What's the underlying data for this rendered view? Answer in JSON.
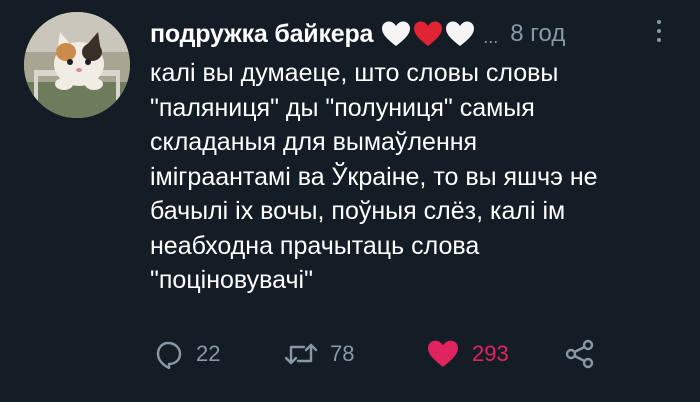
{
  "tweet": {
    "author_name": "подружка байкера",
    "name_emoji": [
      "white-heart",
      "red-heart",
      "white-heart"
    ],
    "ellipsis": "...",
    "time": "8 год",
    "text_lines": [
      "калі вы думаеце, што словы словы",
      "\"паляниця\" ды \"полуниця\" самыя",
      "складаныя для вымаўлення",
      "іміграантамі ва Ўкраіне, то вы яшчэ не",
      "бачылі іх вочы, поўныя слёз, калі ім",
      "неабходна прачытаць слова",
      "\"поціновувачі\""
    ]
  },
  "actions": {
    "reply_count": "22",
    "retweet_count": "78",
    "like_count": "293"
  },
  "icons": {
    "reply": "reply-icon",
    "retweet": "retweet-icon",
    "like": "heart-icon",
    "share": "share-icon",
    "more": "more-vertical-icon"
  },
  "colors": {
    "background": "#141d26",
    "text": "#ffffff",
    "muted": "#8899a6",
    "like": "#e0245e"
  }
}
